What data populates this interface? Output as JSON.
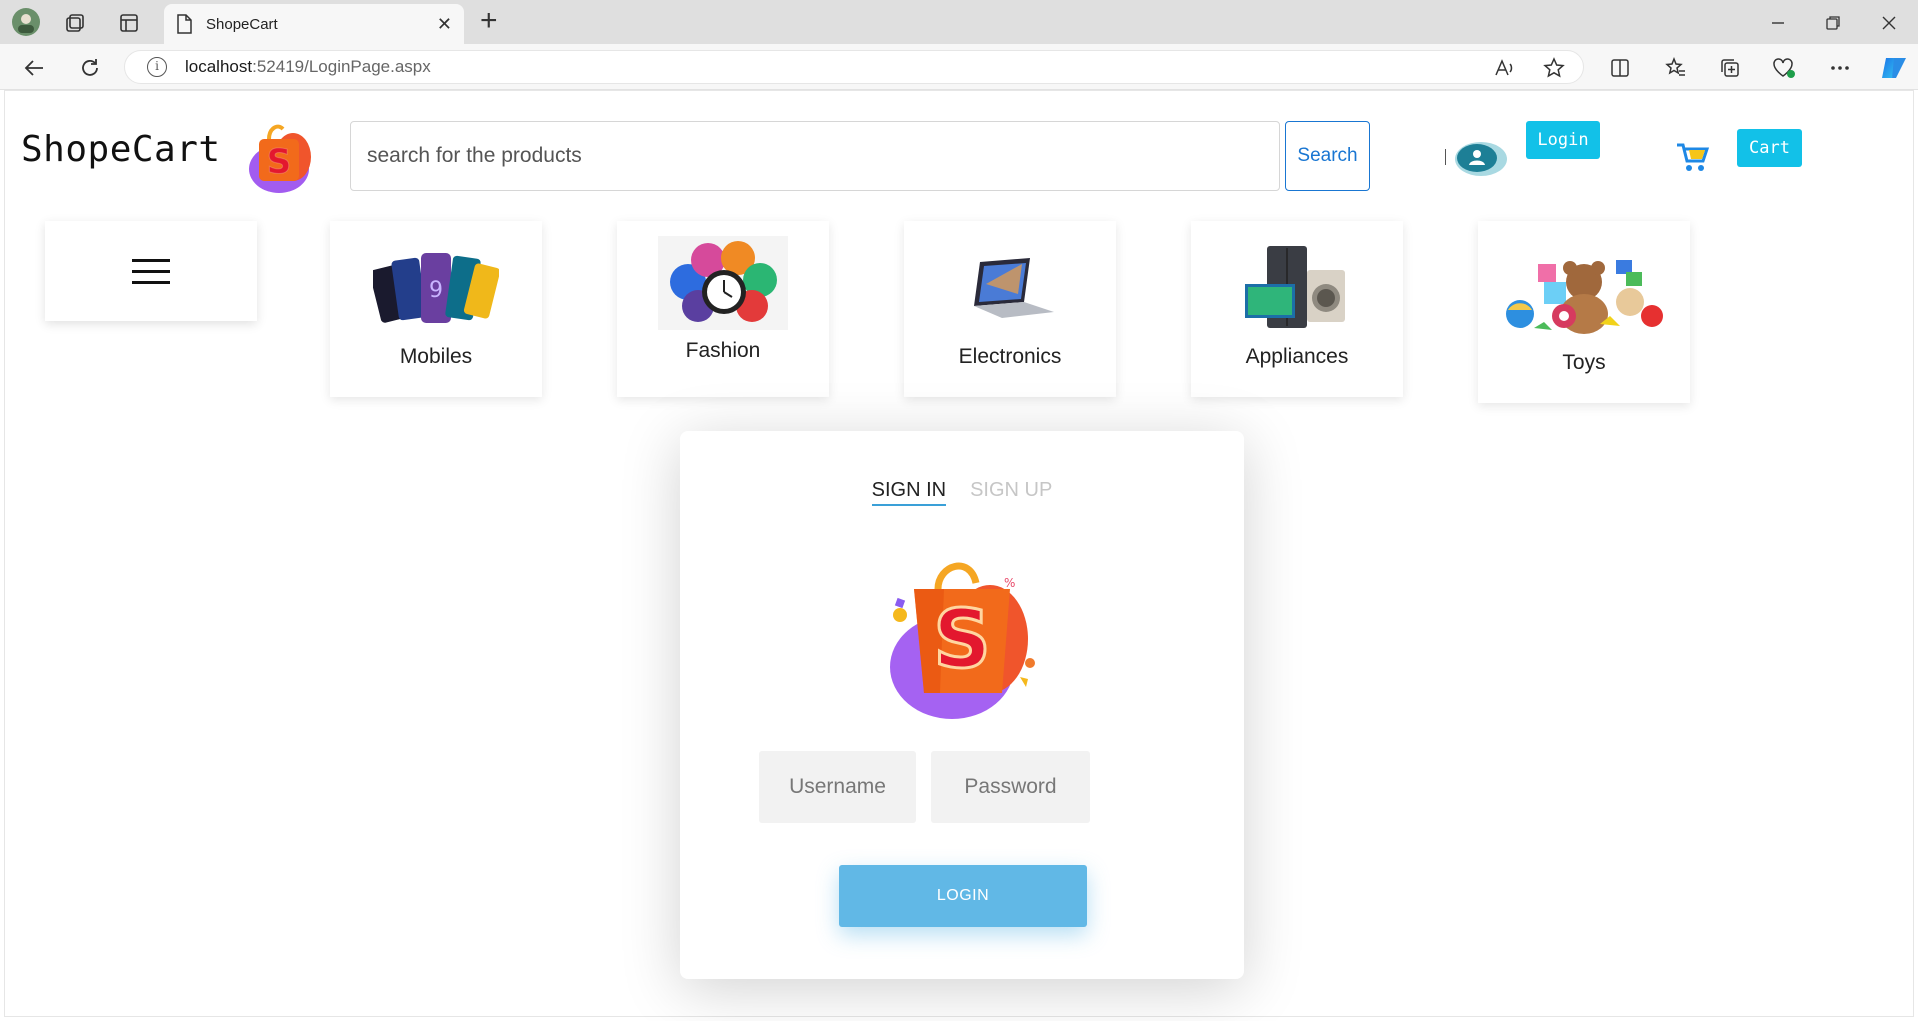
{
  "browser": {
    "tab_title": "ShopeCart",
    "tab_close": "✕",
    "new_tab": "+",
    "url_host": "localhost",
    "url_rest": ":52419/LoginPage.aspx"
  },
  "header": {
    "brand": "ShopeCart",
    "search_placeholder": "search for the products",
    "search_button": "Search",
    "login_button": "Login",
    "cart_button": "Cart"
  },
  "categories": [
    {
      "label": "Mobiles"
    },
    {
      "label": "Fashion"
    },
    {
      "label": "Electronics"
    },
    {
      "label": "Appliances"
    },
    {
      "label": "Toys"
    }
  ],
  "auth": {
    "tab_signin": "SIGN IN",
    "tab_signup": "SIGN UP",
    "username_placeholder": "Username",
    "password_placeholder": "Password",
    "login_button": "LOGIN"
  },
  "colors": {
    "accent": "#12c1e8",
    "search_border": "#1976d2",
    "login_button": "#61b8e6"
  }
}
